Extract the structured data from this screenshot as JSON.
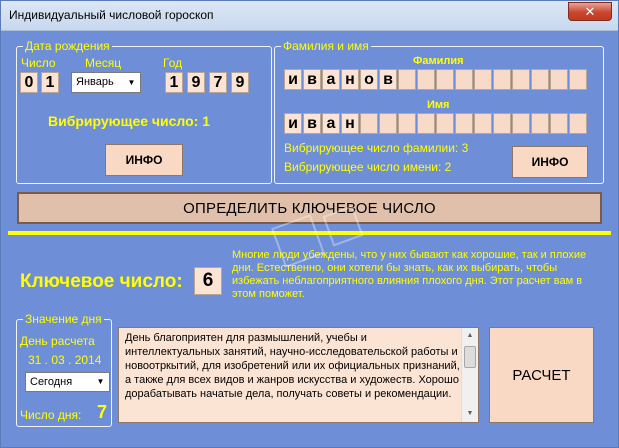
{
  "window": {
    "title": "Индивидуальный числовой гороскоп",
    "close_glyph": "✕"
  },
  "birth": {
    "legend": "Дата рождения",
    "day_label": "Число",
    "month_label": "Месяц",
    "year_label": "Год",
    "day_digits": [
      "0",
      "1"
    ],
    "month_value": "Январь",
    "year_digits": [
      "1",
      "9",
      "7",
      "9"
    ],
    "vibr_label": "Вибрирующее число: 1",
    "info_button": "ИНФО"
  },
  "name": {
    "legend": "Фамилия и имя",
    "surname_label": "Фамилия",
    "name_label": "Имя",
    "surname_letters": [
      "и",
      "в",
      "а",
      "н",
      "о",
      "в",
      "",
      "",
      "",
      "",
      "",
      "",
      "",
      "",
      "",
      ""
    ],
    "name_letters": [
      "и",
      "в",
      "а",
      "н",
      "",
      "",
      "",
      "",
      "",
      "",
      "",
      "",
      "",
      "",
      "",
      ""
    ],
    "vibr_surname": "Вибрирующее число фамилии: 3",
    "vibr_name": "Вибрирующее число имени: 2",
    "info_button": "ИНФО"
  },
  "main_button": "ОПРЕДЕЛИТЬ КЛЮЧЕВОЕ ЧИСЛО",
  "key": {
    "label": "Ключевое число:",
    "value": "6",
    "text": "Многие люди убеждены, что у них бывают как хорошие, так и плохие дни. Естественно, они хотели бы знать, как их выбирать, чтобы избежать неблагоприятного влияния плохого дня. Этот расчет вам в этом поможет."
  },
  "day": {
    "legend": "Значение дня",
    "calc_label": "День расчета",
    "date": "31 . 03 . 2014",
    "select_value": "Сегодня",
    "daynum_label": "Число дня:",
    "daynum_value": "7",
    "description": "День благоприятен для размышлений, учебы и интеллектуальных занятий, научно-исследовательской работы и новоотркытий, для изобретений или их официальных признаний, а также для всех видов и жанров искусства и художеств. Хорошо дорабатывать начатые дела, получать советы и рекомендации.",
    "calc_button": "РАСЧЕТ"
  },
  "colors": {
    "background": "#6f8ed8",
    "accent_text": "#ffff00",
    "cell_fill": "#fce4d4"
  }
}
